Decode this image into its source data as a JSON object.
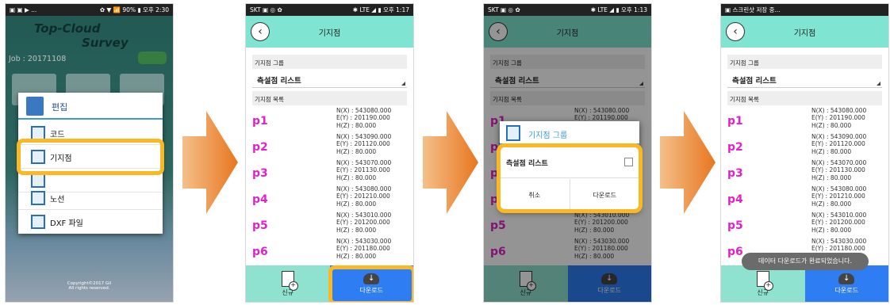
{
  "arrow_color": "#ef8a2e",
  "highlight_color": "#f9b824",
  "phone1": {
    "status_left": "▣ ▣ ▶ ...",
    "status_right": "✿ ▼ 📶 90% ▮ 오후 2:30",
    "app_title_line1": "Top-Cloud",
    "app_title_line2": "Survey",
    "job_label": "Job : 20171108",
    "menu_title": "편집",
    "menu_items": [
      {
        "label": "코드",
        "icon": "code-icon"
      },
      {
        "label": "기지점",
        "icon": "control-point-icon"
      },
      {
        "label": "",
        "icon": "list-icon"
      },
      {
        "label": "노선",
        "icon": "route-icon"
      },
      {
        "label": "DXF 파일",
        "icon": "dxf-file-icon"
      }
    ],
    "footer": "Copyright©2017 Gil\nAll rights reserved."
  },
  "screen_common": {
    "title": "기지점",
    "group_section_label": "기지점 그룹",
    "group_selected": "측설점 리스트",
    "list_section_label": "기지점 목록",
    "points": [
      {
        "name": "p1",
        "nx": "N(X) : 543080.000",
        "ey": "E(Y) : 201190.000",
        "hz": "H(Z) : 80.000"
      },
      {
        "name": "p2",
        "nx": "N(X) : 543090.000",
        "ey": "E(Y) : 201120.000",
        "hz": "H(Z) : 80.000"
      },
      {
        "name": "p3",
        "nx": "N(X) : 543070.000",
        "ey": "E(Y) : 201130.000",
        "hz": "H(Z) : 80.000"
      },
      {
        "name": "p4",
        "nx": "N(X) : 543080.000",
        "ey": "E(Y) : 201210.000",
        "hz": "H(Z) : 80.000"
      },
      {
        "name": "p5",
        "nx": "N(X) : 543010.000",
        "ey": "E(Y) : 201200.000",
        "hz": "H(Z) : 80.000"
      },
      {
        "name": "p6",
        "nx": "N(X) : 543030.000",
        "ey": "E(Y) : 201180.000",
        "hz": "H(Z) : 80.000"
      }
    ],
    "new_button": "신규",
    "download_button": "다운로드"
  },
  "phone2": {
    "status_left": "SKT ▣ ◎ ✿",
    "status_right": "✱ LTE ◢ ▮ 오후 1:17"
  },
  "phone3": {
    "status_left": "SKT ▣ ◎ ✿",
    "status_right": "✱ LTE ◢ ▮ 오후 1:13",
    "dialog_title": "기지점 그룹",
    "dialog_option": "측설점 리스트",
    "dialog_cancel": "취소",
    "dialog_download": "다운로드"
  },
  "phone4": {
    "status_left": "▣ 스크린샷 저장 중...",
    "status_right": "",
    "toast": "데이터 다운로드가 완료되었습니다."
  }
}
